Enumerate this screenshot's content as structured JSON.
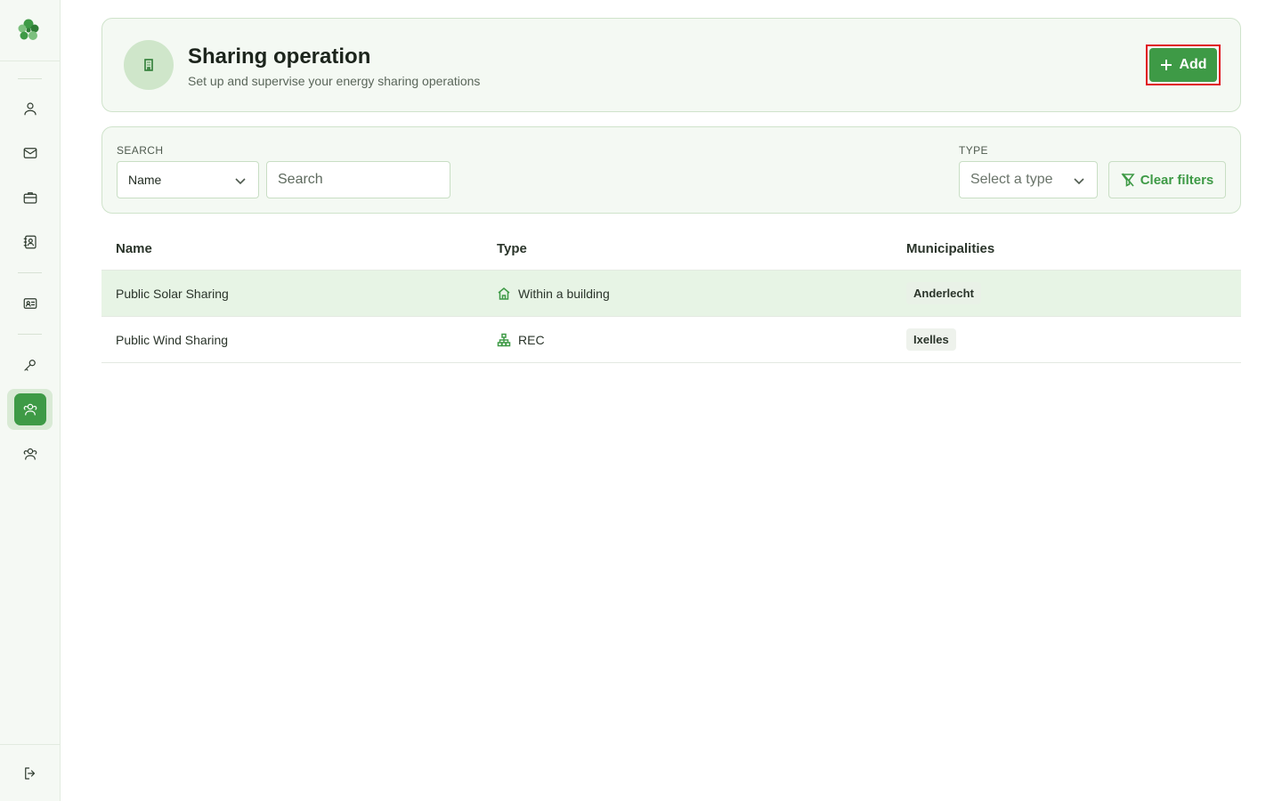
{
  "sidebar": {
    "logo": "clover-logo",
    "items": [
      {
        "name": "user-icon",
        "active": false
      },
      {
        "name": "mail-icon",
        "active": false
      },
      {
        "name": "briefcase-icon",
        "active": false
      },
      {
        "name": "contact-book-icon",
        "active": false
      },
      {
        "name": "id-card-icon",
        "active": false
      },
      {
        "name": "key-icon",
        "active": false
      },
      {
        "name": "users-icon",
        "active": true
      },
      {
        "name": "groups-icon",
        "active": false
      }
    ],
    "logout": "logout-icon"
  },
  "header": {
    "title": "Sharing operation",
    "subtitle": "Set up and supervise your energy sharing operations",
    "add_label": "Add"
  },
  "filters": {
    "search_label": "SEARCH",
    "field_select": "Name",
    "search_placeholder": "Search",
    "type_label": "TYPE",
    "type_placeholder": "Select a type",
    "clear_label": "Clear filters"
  },
  "table": {
    "columns": [
      "Name",
      "Type",
      "Municipalities"
    ],
    "rows": [
      {
        "name": "Public Solar Sharing",
        "type": "Within a building",
        "type_icon": "home-icon",
        "municipality": "Anderlecht"
      },
      {
        "name": "Public Wind Sharing",
        "type": "REC",
        "type_icon": "network-icon",
        "municipality": "Ixelles"
      }
    ]
  },
  "colors": {
    "accent": "#3e9a46",
    "highlight_row": "#e7f4e5",
    "card_bg": "#f4f9f3",
    "add_outline": "#e0111d"
  }
}
